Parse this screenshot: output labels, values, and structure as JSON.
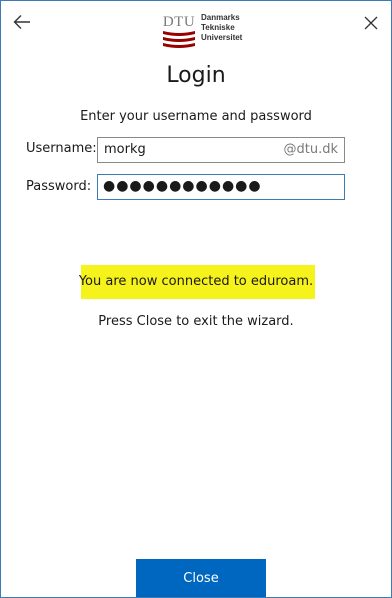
{
  "header": {
    "logo": {
      "abbr": "DTU",
      "lines": [
        "Danmarks",
        "Tekniske",
        "Universitet"
      ],
      "color": "#990000"
    },
    "back_icon": "arrow-left-icon",
    "close_icon": "close-icon"
  },
  "title": "Login",
  "instruction": "Enter your username and password",
  "form": {
    "username_label": "Username:",
    "username_value": "morkg",
    "domain_suffix": "@dtu.dk",
    "password_label": "Password:",
    "password_masked": "●●●●●●●●●●●●"
  },
  "status": {
    "message": "You are now connected to eduroam.",
    "highlight_color": "#f5f21c",
    "hint": "Press Close to exit the wizard."
  },
  "footer": {
    "close_label": "Close",
    "accent_color": "#0067c0"
  }
}
